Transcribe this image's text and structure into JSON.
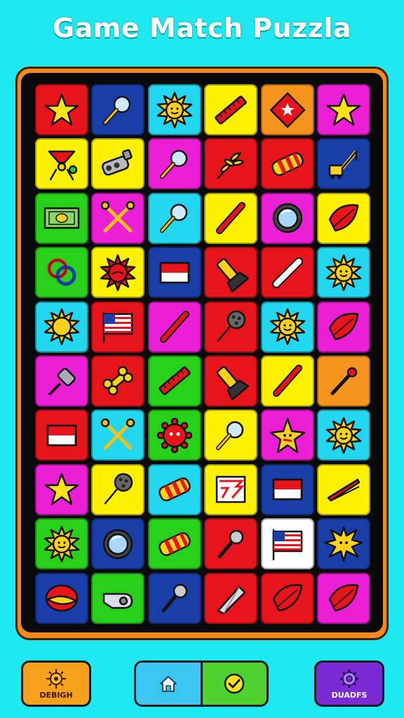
{
  "title": "Game Match Puzzla",
  "colors": {
    "background": "#1ee8f0",
    "board_frame": "#f28a1c",
    "board": "#0a0a0a"
  },
  "tiles": [
    [
      {
        "bg": "#e8141b",
        "icon": "star-icon"
      },
      {
        "bg": "#1a3ea8",
        "icon": "magnifier-icon"
      },
      {
        "bg": "#22d7ef",
        "icon": "sun-face-icon"
      },
      {
        "bg": "#fff200",
        "icon": "ruler-icon"
      },
      {
        "bg": "#f7941d",
        "icon": "diamond-star-icon"
      },
      {
        "bg": "#ec1ed6",
        "icon": "star-icon"
      }
    ],
    [
      {
        "bg": "#fff200",
        "icon": "funnel-stand-icon"
      },
      {
        "bg": "#fff200",
        "icon": "pipe-fitting-icon"
      },
      {
        "bg": "#ec1ed6",
        "icon": "magnifier-icon"
      },
      {
        "bg": "#e8141b",
        "icon": "wheat-icon"
      },
      {
        "bg": "#e8141b",
        "icon": "cracker-icon"
      },
      {
        "bg": "#1a3ea8",
        "icon": "crane-icon"
      }
    ],
    [
      {
        "bg": "#27d11a",
        "icon": "banknote-icon"
      },
      {
        "bg": "#ec1ed6",
        "icon": "crossed-keys-icon"
      },
      {
        "bg": "#22d7ef",
        "icon": "magnifier-icon"
      },
      {
        "bg": "#fff200",
        "icon": "stick-icon"
      },
      {
        "bg": "#ec1ed6",
        "icon": "lens-icon"
      },
      {
        "bg": "#fff200",
        "icon": "leaf-icon"
      }
    ],
    [
      {
        "bg": "#27d11a",
        "icon": "knot-icon"
      },
      {
        "bg": "#fff200",
        "icon": "red-sun-icon"
      },
      {
        "bg": "#1a3ea8",
        "icon": "flag-icon"
      },
      {
        "bg": "#e8141b",
        "icon": "flashlight-icon"
      },
      {
        "bg": "#e8141b",
        "icon": "chalk-icon"
      },
      {
        "bg": "#22d7ef",
        "icon": "sun-face-icon"
      }
    ],
    [
      {
        "bg": "#22d7ef",
        "icon": "sun-icon"
      },
      {
        "bg": "#e8141b",
        "icon": "us-flag-icon"
      },
      {
        "bg": "#ec1ed6",
        "icon": "stick-icon"
      },
      {
        "bg": "#e8141b",
        "icon": "mace-icon"
      },
      {
        "bg": "#22d7ef",
        "icon": "sun-face-icon"
      },
      {
        "bg": "#ec1ed6",
        "icon": "leaf-icon"
      }
    ],
    [
      {
        "bg": "#ec1ed6",
        "icon": "screwdriver-icon"
      },
      {
        "bg": "#e8141b",
        "icon": "bone-icon"
      },
      {
        "bg": "#27d11a",
        "icon": "ruler-icon"
      },
      {
        "bg": "#e8141b",
        "icon": "flashlight-icon"
      },
      {
        "bg": "#fff200",
        "icon": "stick-icon"
      },
      {
        "bg": "#f7941d",
        "icon": "match-icon"
      }
    ],
    [
      {
        "bg": "#e8141b",
        "icon": "flag-icon"
      },
      {
        "bg": "#22d7ef",
        "icon": "crossed-keys-icon"
      },
      {
        "bg": "#27d11a",
        "icon": "gear-face-icon"
      },
      {
        "bg": "#fff200",
        "icon": "magnifier-icon"
      },
      {
        "bg": "#ec1ed6",
        "icon": "star-face-icon"
      },
      {
        "bg": "#22d7ef",
        "icon": "sun-face-icon"
      }
    ],
    [
      {
        "bg": "#ec1ed6",
        "icon": "star-icon"
      },
      {
        "bg": "#fff200",
        "icon": "mace-icon"
      },
      {
        "bg": "#22d7ef",
        "icon": "cracker-icon"
      },
      {
        "bg": "#fff200",
        "icon": "pattern-icon"
      },
      {
        "bg": "#1a3ea8",
        "icon": "flag-icon"
      },
      {
        "bg": "#fff200",
        "icon": "tweezers-icon"
      }
    ],
    [
      {
        "bg": "#27d11a",
        "icon": "sun-face-icon"
      },
      {
        "bg": "#1a3ea8",
        "icon": "lens-icon"
      },
      {
        "bg": "#27d11a",
        "icon": "cracker-icon"
      },
      {
        "bg": "#e8141b",
        "icon": "microphone-icon"
      },
      {
        "bg": "#ffffff",
        "icon": "us-flag-icon"
      },
      {
        "bg": "#1a3ea8",
        "icon": "splat-face-icon"
      }
    ],
    [
      {
        "bg": "#1a3ea8",
        "icon": "bean-icon"
      },
      {
        "bg": "#27d11a",
        "icon": "whistle-icon"
      },
      {
        "bg": "#1a3ea8",
        "icon": "microphone-icon"
      },
      {
        "bg": "#e8141b",
        "icon": "blade-icon"
      },
      {
        "bg": "#e8141b",
        "icon": "leaf-icon"
      },
      {
        "bg": "#ec1ed6",
        "icon": "leaf-icon"
      }
    ]
  ],
  "buttons": {
    "left_label": "DEBIGH",
    "left_icon": "gear-sun-icon",
    "right_label": "DUADFS",
    "right_icon": "gear-icon",
    "home_icon": "home-icon",
    "check_icon": "check-icon"
  }
}
